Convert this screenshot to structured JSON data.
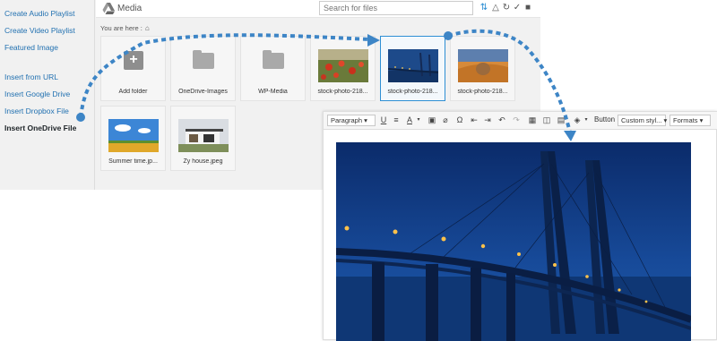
{
  "sidebar": {
    "items": [
      {
        "label": "Create Audio Playlist"
      },
      {
        "label": "Create Video Playlist"
      },
      {
        "label": "Featured Image"
      },
      {
        "label": "Insert from URL"
      },
      {
        "label": "Insert Google Drive"
      },
      {
        "label": "Insert Dropbox File"
      },
      {
        "label": "Insert OneDrive File"
      }
    ]
  },
  "header": {
    "title": "Media",
    "search_placeholder": "Search for files"
  },
  "breadcrumb": {
    "label": "You are here :"
  },
  "tiles": [
    {
      "label": "Add folder",
      "kind": "add-folder"
    },
    {
      "label": "OneDrive-Images",
      "kind": "folder"
    },
    {
      "label": "WP-Media",
      "kind": "folder"
    },
    {
      "label": "stock-photo-218...",
      "kind": "image-poppies"
    },
    {
      "label": "stock-photo-218...",
      "kind": "image-bridge",
      "selected": true
    },
    {
      "label": "stock-photo-218...",
      "kind": "image-desert"
    },
    {
      "label": "Summer time.jp...",
      "kind": "image-field"
    },
    {
      "label": "Zy house.jpeg",
      "kind": "image-house"
    }
  ],
  "editor": {
    "toolbar": {
      "paragraph": "Paragraph",
      "button": "Button",
      "custom_style": "Custom styl...",
      "formats": "Formats"
    }
  },
  "colors": {
    "accent": "#2e8fd4",
    "link": "#2271b1",
    "arrow": "#3d85c6"
  }
}
